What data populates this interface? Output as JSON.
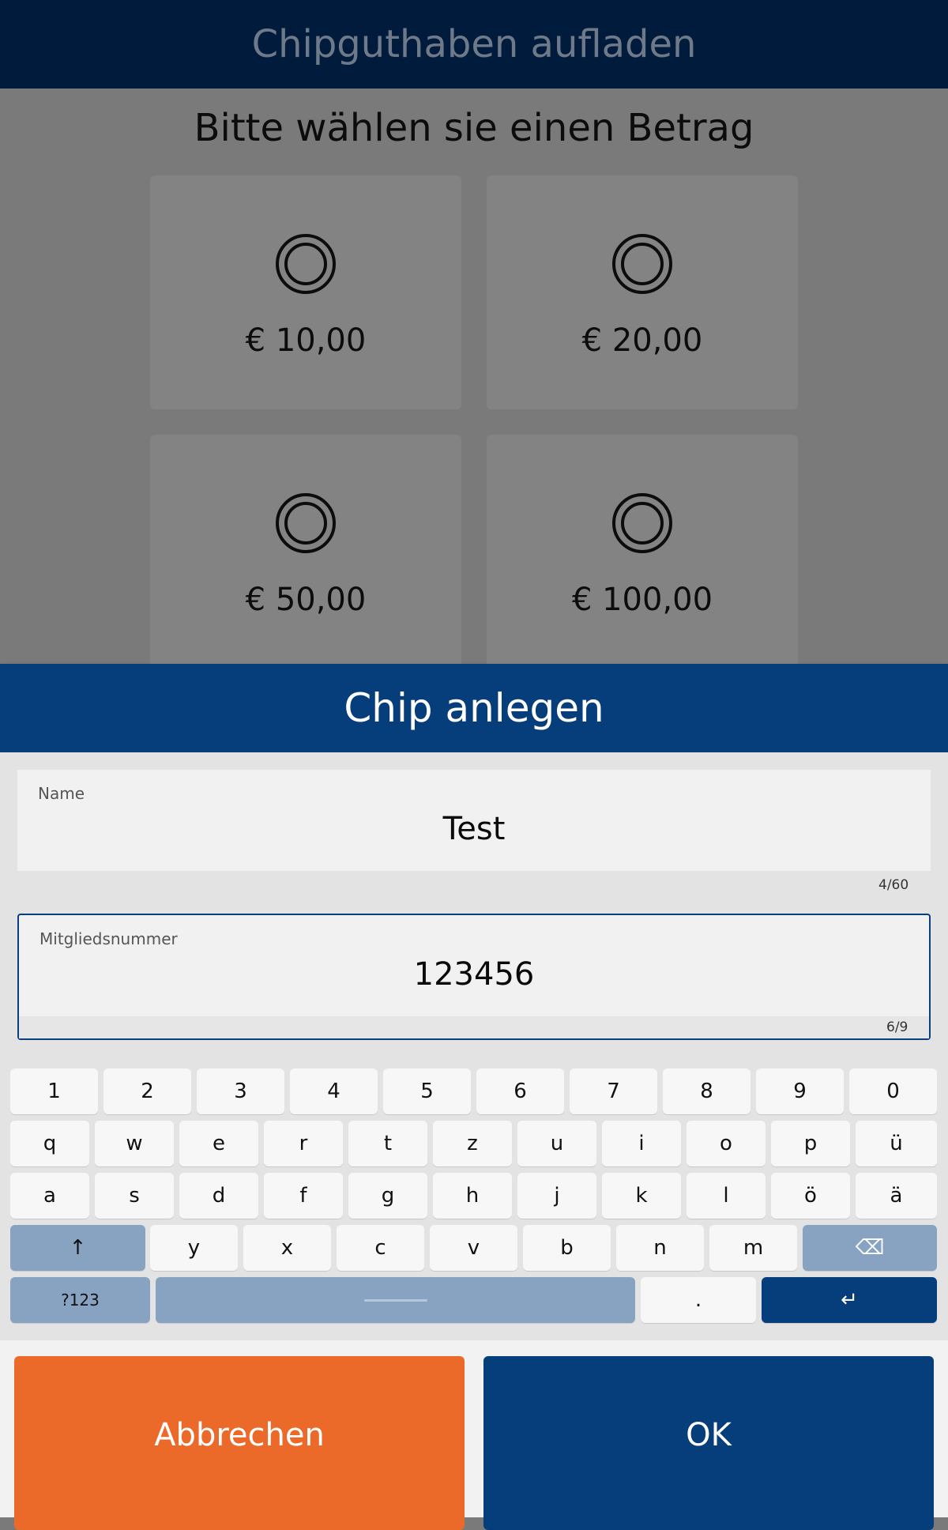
{
  "background_screen": {
    "title": "Chipguthaben aufladen",
    "prompt": "Bitte wählen sie einen Betrag",
    "amounts": [
      "€ 10,00",
      "€ 20,00",
      "€ 50,00",
      "€ 100,00"
    ],
    "icon": "coin-icon"
  },
  "dialog": {
    "title": "Chip anlegen",
    "fields": [
      {
        "label": "Name",
        "value": "Test",
        "counter": "4/60"
      },
      {
        "label": "Mitgliedsnummer",
        "value": "123456",
        "counter": "6/9"
      }
    ],
    "cancel_label": "Abbrechen",
    "ok_label": "OK"
  },
  "keyboard": {
    "row1": [
      "1",
      "2",
      "3",
      "4",
      "5",
      "6",
      "7",
      "8",
      "9",
      "0"
    ],
    "row2": [
      "q",
      "w",
      "e",
      "r",
      "t",
      "z",
      "u",
      "i",
      "o",
      "p",
      "ü"
    ],
    "row3": [
      "a",
      "s",
      "d",
      "f",
      "g",
      "h",
      "j",
      "k",
      "l",
      "ö",
      "ä"
    ],
    "row4": [
      "y",
      "x",
      "c",
      "v",
      "b",
      "n",
      "m"
    ],
    "shift_icon": "↑",
    "backspace_icon": "⌫",
    "symbols_label": "?123",
    "period_label": ".",
    "enter_icon": "↵"
  },
  "colors": {
    "header_dark": "#001b3b",
    "dialog_blue": "#063d7b",
    "cancel_orange": "#ec6a29",
    "key_modifier": "#88a3c2"
  }
}
